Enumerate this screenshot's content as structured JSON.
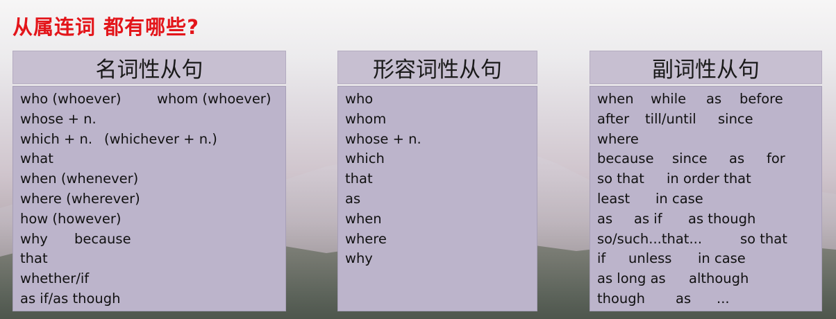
{
  "slide": {
    "title": "从属连词 都有哪些?"
  },
  "panels": [
    {
      "header": "名词性从句",
      "rows": [
        [
          "who (whoever)",
          "whom (whoever)"
        ],
        [
          "whose + n."
        ],
        [
          "which + n.",
          "(whichever + n.)"
        ],
        [
          "what"
        ],
        [
          "when (whenever)"
        ],
        [
          "where (wherever)"
        ],
        [
          "how (however)"
        ],
        [
          "why",
          "because"
        ],
        [
          "that"
        ],
        [
          "whether/if"
        ],
        [
          "as if/as though"
        ]
      ]
    },
    {
      "header": "形容词性从句",
      "rows": [
        [
          "who"
        ],
        [
          "whom"
        ],
        [
          "whose + n."
        ],
        [
          "which"
        ],
        [
          "that"
        ],
        [
          "as"
        ],
        [
          "when"
        ],
        [
          "where"
        ],
        [
          "why"
        ]
      ]
    },
    {
      "header": "副词性从句",
      "rows": [
        [
          "when",
          "while",
          "as",
          "before"
        ],
        [
          "after",
          "till/until",
          "since"
        ],
        [
          "where"
        ],
        [
          "because",
          "since",
          "as",
          "for"
        ],
        [
          "so that",
          "in order that"
        ],
        [
          "least",
          "in case"
        ],
        [
          "as",
          "as if",
          "as though"
        ],
        [
          "so/such...that...",
          "so that"
        ],
        [
          "if",
          "unless",
          "in case"
        ],
        [
          "as long as",
          "although"
        ],
        [
          "though",
          "as",
          "..."
        ]
      ]
    }
  ]
}
